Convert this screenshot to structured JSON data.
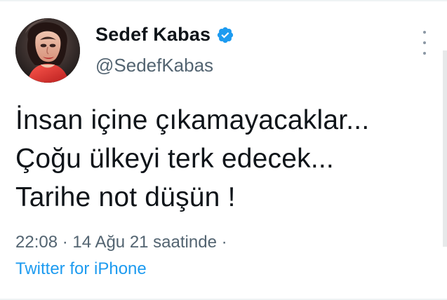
{
  "tweet": {
    "display_name": "Sedef Kabas",
    "handle": "@SedefKabas",
    "verified_icon": "verified-check-icon",
    "more_icon": "vertical-ellipsis-icon",
    "lines": [
      "İnsan içine çıkamayacaklar...",
      "Çoğu ülkeyi terk edecek...",
      "Tarihe not düşün !"
    ],
    "time": "22:08",
    "separator_1": "·",
    "date": "14 Ağu 21 saatinde",
    "separator_2": "·",
    "source": "Twitter for iPhone"
  },
  "colors": {
    "text": "#0f1419",
    "muted": "#536471",
    "link": "#1d9bf0",
    "verified": "#1d9bf0",
    "border": "#eff3f4"
  }
}
